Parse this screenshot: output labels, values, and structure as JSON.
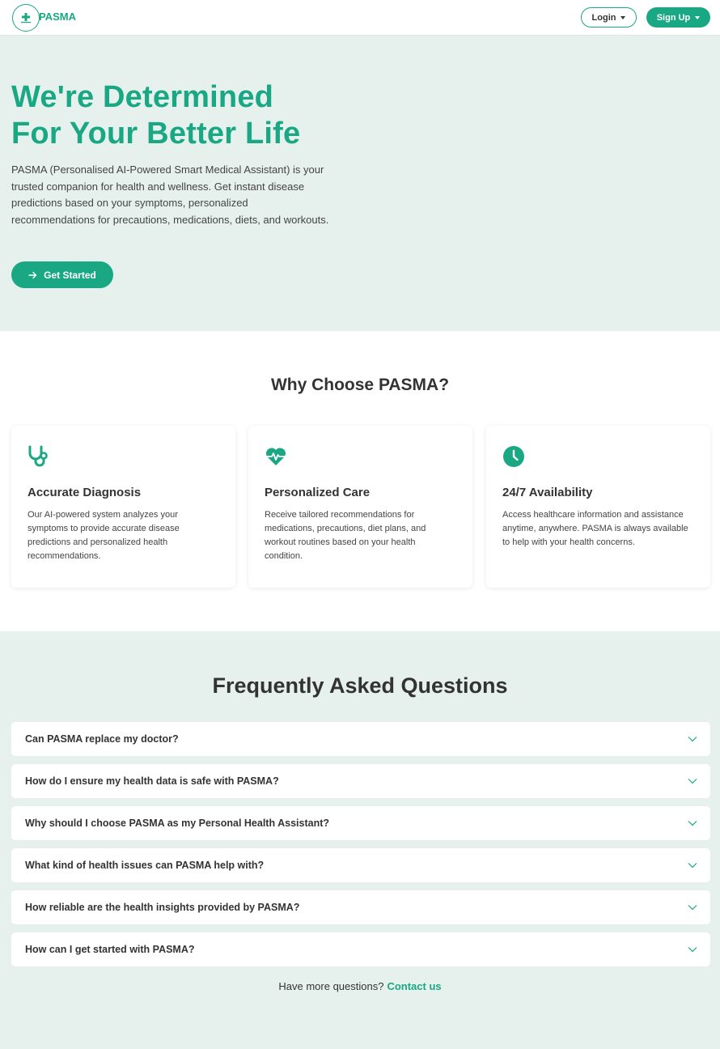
{
  "nav": {
    "brand": "PASMA",
    "login_label": "Login",
    "signup_label": "Sign Up",
    "logo_icon": "medical-cross-logo-icon"
  },
  "hero": {
    "title_line1": "We're Determined",
    "title_line2": "For Your Better Life",
    "description": "PASMA (Personalised AI-Powered Smart Medical Assistant) is your trusted companion for health and wellness. Get instant disease predictions based on your symptoms, personalized recommendations for precautions, medications, diets, and workouts.",
    "cta_label": "Get Started",
    "cta_icon": "arrow-right-icon"
  },
  "features": {
    "heading": "Why Choose PASMA?",
    "cards": [
      {
        "icon": "stethoscope-icon",
        "title": "Accurate Diagnosis",
        "text": "Our AI-powered system analyzes your symptoms to provide accurate disease predictions and personalized health recommendations."
      },
      {
        "icon": "heart-pulse-icon",
        "title": "Personalized Care",
        "text": "Receive tailored recommendations for medications, precautions, diet plans, and workout routines based on your health condition."
      },
      {
        "icon": "clock-icon",
        "title": "24/7 Availability",
        "text": "Access healthcare information and assistance anytime, anywhere. PASMA is always available to help with your health concerns."
      }
    ]
  },
  "faq": {
    "heading": "Frequently Asked Questions",
    "items": [
      "Can PASMA replace my doctor?",
      "How do I ensure my health data is safe with PASMA?",
      "Why should I choose PASMA as my Personal Health Assistant?",
      "What kind of health issues can PASMA help with?",
      "How reliable are the health insights provided by PASMA?",
      "How can I get started with PASMA?"
    ],
    "more_text": "Have more questions?",
    "contact_label": "Contact us"
  },
  "colors": {
    "accent": "#19a784",
    "background": "#e6f1ee"
  }
}
